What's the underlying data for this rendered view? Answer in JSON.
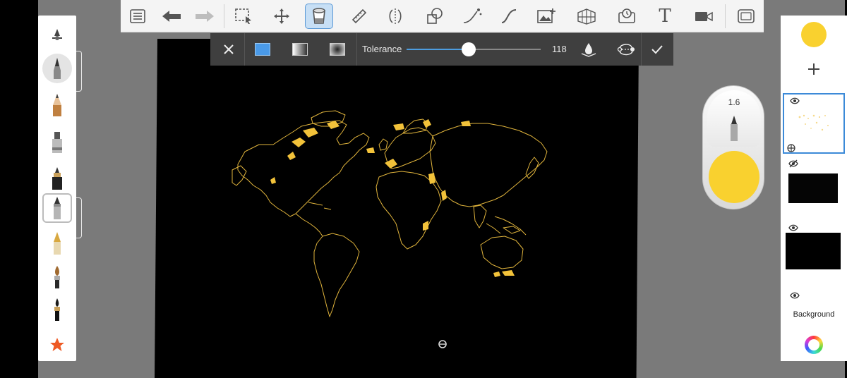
{
  "toolbar": {
    "items": [
      {
        "name": "layers-list",
        "icon": "list-icon"
      },
      {
        "name": "undo",
        "icon": "undo-arrow-icon"
      },
      {
        "name": "redo",
        "icon": "redo-arrow-icon"
      },
      {
        "name": "selection",
        "icon": "selection-icon"
      },
      {
        "name": "transform",
        "icon": "move-arrows-icon"
      },
      {
        "name": "fill",
        "icon": "paint-bucket-icon",
        "active": true
      },
      {
        "name": "ruler",
        "icon": "ruler-icon"
      },
      {
        "name": "symmetry",
        "icon": "symmetry-icon"
      },
      {
        "name": "shapes",
        "icon": "shapes-icon"
      },
      {
        "name": "stroke",
        "icon": "stroke-curve-icon"
      },
      {
        "name": "curve",
        "icon": "s-curve-icon"
      },
      {
        "name": "image",
        "icon": "add-image-icon"
      },
      {
        "name": "perspective",
        "icon": "perspective-grid-icon"
      },
      {
        "name": "timelapse",
        "icon": "timelapse-icon"
      },
      {
        "name": "text",
        "icon": "text-icon",
        "label": "T"
      },
      {
        "name": "record",
        "icon": "video-camera-icon"
      },
      {
        "name": "fullscreen",
        "icon": "fullscreen-icon"
      }
    ]
  },
  "fill_bar": {
    "close_icon": "close-icon",
    "fill_modes": [
      "solid-fill-icon",
      "linear-gradient-icon",
      "radial-gradient-icon"
    ],
    "tolerance_label": "Tolerance",
    "tolerance_value": "118",
    "tolerance_max": 255,
    "sample_icon": "sample-layer-icon",
    "transform_icon": "gradient-transform-icon",
    "confirm_icon": "checkmark-icon"
  },
  "brush_palette": {
    "brushes": [
      "brush-settings-icon",
      "pencil-active-icon",
      "pencil-icon",
      "marker-icon",
      "airbrush-icon",
      "ballpoint-pen-icon",
      "fountain-pen-icon",
      "paint-brush-icon",
      "ink-brush-icon",
      "favorites-star-icon"
    ]
  },
  "puck": {
    "brush_size": "1.6",
    "color": "#f9d12f"
  },
  "layers_panel": {
    "current_color": "#f9d12f",
    "add_layer_icon": "plus-icon",
    "layers": [
      {
        "name": "layer-map-outline",
        "selected": true
      },
      {
        "name": "layer-dark-map",
        "hidden": true
      },
      {
        "name": "layer-black"
      },
      {
        "name": "background",
        "label": "Background"
      }
    ],
    "color_wheel_icon": "color-wheel-icon"
  },
  "colors": {
    "accent_blue": "#3c8ad8",
    "fill_yellow": "#f9d12f",
    "toolbar_bg": "#f4f4f4",
    "fill_bar_bg": "#3f3f3f",
    "canvas_bg": "#000000"
  }
}
